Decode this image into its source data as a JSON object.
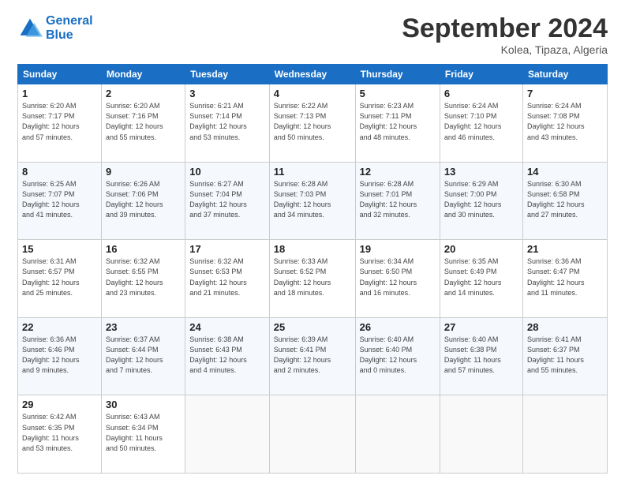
{
  "header": {
    "logo_line1": "General",
    "logo_line2": "Blue",
    "month": "September 2024",
    "location": "Kolea, Tipaza, Algeria"
  },
  "weekdays": [
    "Sunday",
    "Monday",
    "Tuesday",
    "Wednesday",
    "Thursday",
    "Friday",
    "Saturday"
  ],
  "weeks": [
    [
      {
        "day": "1",
        "info": "Sunrise: 6:20 AM\nSunset: 7:17 PM\nDaylight: 12 hours\nand 57 minutes."
      },
      {
        "day": "2",
        "info": "Sunrise: 6:20 AM\nSunset: 7:16 PM\nDaylight: 12 hours\nand 55 minutes."
      },
      {
        "day": "3",
        "info": "Sunrise: 6:21 AM\nSunset: 7:14 PM\nDaylight: 12 hours\nand 53 minutes."
      },
      {
        "day": "4",
        "info": "Sunrise: 6:22 AM\nSunset: 7:13 PM\nDaylight: 12 hours\nand 50 minutes."
      },
      {
        "day": "5",
        "info": "Sunrise: 6:23 AM\nSunset: 7:11 PM\nDaylight: 12 hours\nand 48 minutes."
      },
      {
        "day": "6",
        "info": "Sunrise: 6:24 AM\nSunset: 7:10 PM\nDaylight: 12 hours\nand 46 minutes."
      },
      {
        "day": "7",
        "info": "Sunrise: 6:24 AM\nSunset: 7:08 PM\nDaylight: 12 hours\nand 43 minutes."
      }
    ],
    [
      {
        "day": "8",
        "info": "Sunrise: 6:25 AM\nSunset: 7:07 PM\nDaylight: 12 hours\nand 41 minutes."
      },
      {
        "day": "9",
        "info": "Sunrise: 6:26 AM\nSunset: 7:06 PM\nDaylight: 12 hours\nand 39 minutes."
      },
      {
        "day": "10",
        "info": "Sunrise: 6:27 AM\nSunset: 7:04 PM\nDaylight: 12 hours\nand 37 minutes."
      },
      {
        "day": "11",
        "info": "Sunrise: 6:28 AM\nSunset: 7:03 PM\nDaylight: 12 hours\nand 34 minutes."
      },
      {
        "day": "12",
        "info": "Sunrise: 6:28 AM\nSunset: 7:01 PM\nDaylight: 12 hours\nand 32 minutes."
      },
      {
        "day": "13",
        "info": "Sunrise: 6:29 AM\nSunset: 7:00 PM\nDaylight: 12 hours\nand 30 minutes."
      },
      {
        "day": "14",
        "info": "Sunrise: 6:30 AM\nSunset: 6:58 PM\nDaylight: 12 hours\nand 27 minutes."
      }
    ],
    [
      {
        "day": "15",
        "info": "Sunrise: 6:31 AM\nSunset: 6:57 PM\nDaylight: 12 hours\nand 25 minutes."
      },
      {
        "day": "16",
        "info": "Sunrise: 6:32 AM\nSunset: 6:55 PM\nDaylight: 12 hours\nand 23 minutes."
      },
      {
        "day": "17",
        "info": "Sunrise: 6:32 AM\nSunset: 6:53 PM\nDaylight: 12 hours\nand 21 minutes."
      },
      {
        "day": "18",
        "info": "Sunrise: 6:33 AM\nSunset: 6:52 PM\nDaylight: 12 hours\nand 18 minutes."
      },
      {
        "day": "19",
        "info": "Sunrise: 6:34 AM\nSunset: 6:50 PM\nDaylight: 12 hours\nand 16 minutes."
      },
      {
        "day": "20",
        "info": "Sunrise: 6:35 AM\nSunset: 6:49 PM\nDaylight: 12 hours\nand 14 minutes."
      },
      {
        "day": "21",
        "info": "Sunrise: 6:36 AM\nSunset: 6:47 PM\nDaylight: 12 hours\nand 11 minutes."
      }
    ],
    [
      {
        "day": "22",
        "info": "Sunrise: 6:36 AM\nSunset: 6:46 PM\nDaylight: 12 hours\nand 9 minutes."
      },
      {
        "day": "23",
        "info": "Sunrise: 6:37 AM\nSunset: 6:44 PM\nDaylight: 12 hours\nand 7 minutes."
      },
      {
        "day": "24",
        "info": "Sunrise: 6:38 AM\nSunset: 6:43 PM\nDaylight: 12 hours\nand 4 minutes."
      },
      {
        "day": "25",
        "info": "Sunrise: 6:39 AM\nSunset: 6:41 PM\nDaylight: 12 hours\nand 2 minutes."
      },
      {
        "day": "26",
        "info": "Sunrise: 6:40 AM\nSunset: 6:40 PM\nDaylight: 12 hours\nand 0 minutes."
      },
      {
        "day": "27",
        "info": "Sunrise: 6:40 AM\nSunset: 6:38 PM\nDaylight: 11 hours\nand 57 minutes."
      },
      {
        "day": "28",
        "info": "Sunrise: 6:41 AM\nSunset: 6:37 PM\nDaylight: 11 hours\nand 55 minutes."
      }
    ],
    [
      {
        "day": "29",
        "info": "Sunrise: 6:42 AM\nSunset: 6:35 PM\nDaylight: 11 hours\nand 53 minutes."
      },
      {
        "day": "30",
        "info": "Sunrise: 6:43 AM\nSunset: 6:34 PM\nDaylight: 11 hours\nand 50 minutes."
      },
      {
        "day": "",
        "info": ""
      },
      {
        "day": "",
        "info": ""
      },
      {
        "day": "",
        "info": ""
      },
      {
        "day": "",
        "info": ""
      },
      {
        "day": "",
        "info": ""
      }
    ]
  ]
}
